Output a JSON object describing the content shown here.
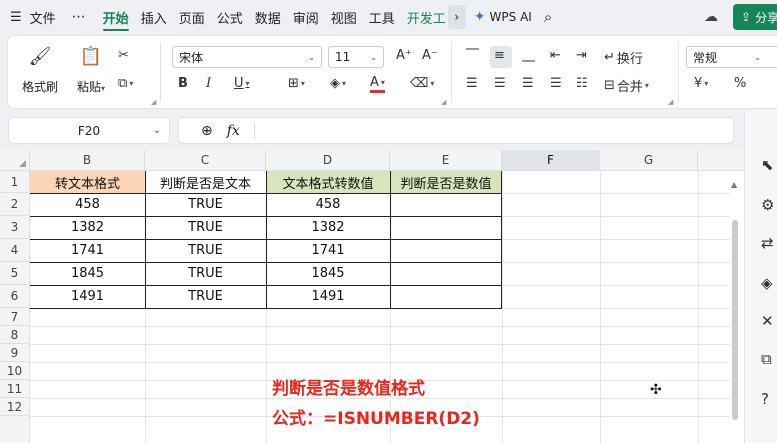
{
  "menu": {
    "hamburger": "☰",
    "file": "文件",
    "more": "⋯",
    "tabs": [
      "开始",
      "插入",
      "页面",
      "公式",
      "数据",
      "审阅",
      "视图",
      "工具",
      "开发工"
    ],
    "active_tab": "开始",
    "chevron": "›",
    "wps_ai": "WPS AI",
    "share": "分享"
  },
  "ribbon": {
    "format_painter": "格式刷",
    "paste": "粘贴",
    "font_name": "宋体",
    "font_size": "11",
    "wrap": "换行",
    "merge": "合并",
    "number_format": "常规",
    "currency": "¥",
    "percent": "%"
  },
  "formula_bar": {
    "cell_ref": "F20",
    "formula": ""
  },
  "columns": [
    "B",
    "C",
    "D",
    "E",
    "F",
    "G"
  ],
  "selected_column": "F",
  "rows": [
    "1",
    "2",
    "3",
    "4",
    "5",
    "6",
    "7",
    "8",
    "9",
    "10",
    "11",
    "12"
  ],
  "table": {
    "headers": [
      "转文本格式",
      "判断是否是文本",
      "文本格式转数值",
      "判断是否是数值"
    ],
    "header_colors": [
      "#fbd5b5",
      "#ffffff",
      "#d8e4bc",
      "#d8e4bc"
    ],
    "data": [
      [
        "458",
        "TRUE",
        "458",
        ""
      ],
      [
        "1382",
        "TRUE",
        "1382",
        ""
      ],
      [
        "1741",
        "TRUE",
        "1741",
        ""
      ],
      [
        "1845",
        "TRUE",
        "1845",
        ""
      ],
      [
        "1491",
        "TRUE",
        "1491",
        ""
      ]
    ]
  },
  "annotation": {
    "line1": "判断是否是数值格式",
    "line2": "公式：=ISNUMBER(D2)",
    "color": "#e8281e"
  },
  "accent_color": "#16865a"
}
